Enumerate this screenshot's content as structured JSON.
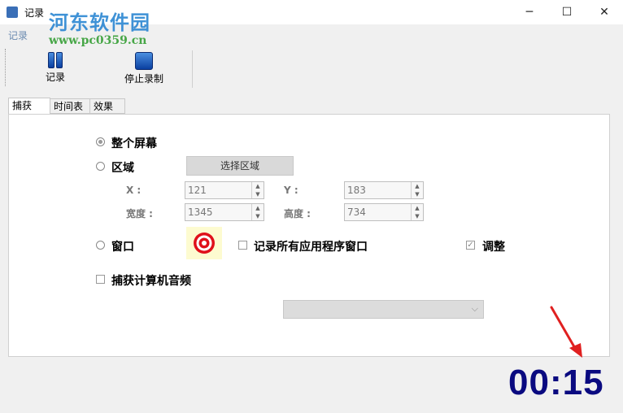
{
  "window": {
    "title": "记录",
    "minimize_glyph": "─",
    "maximize_glyph": "☐",
    "close_glyph": "✕"
  },
  "watermark": {
    "site_name": "河东软件园",
    "url": "www.pc0359.cn"
  },
  "menu": {
    "label": "记录"
  },
  "toolbar": {
    "record_label": "记录",
    "stop_label": "停止录制"
  },
  "tabs": [
    {
      "label": "捕获",
      "active": true
    },
    {
      "label": "时间表",
      "active": false
    },
    {
      "label": "效果",
      "active": false
    }
  ],
  "capture": {
    "fullscreen_label": "整个屏幕",
    "fullscreen_checked": true,
    "region_label": "区域",
    "region_checked": false,
    "select_region_button": "选择区域",
    "x_label": "X :",
    "x_value": "121",
    "y_label": "Y :",
    "y_value": "183",
    "width_label": "宽度 :",
    "width_value": "1345",
    "height_label": "高度 :",
    "height_value": "734",
    "window_label": "窗口",
    "window_checked": false,
    "record_all_windows_label": "记录所有应用程序窗口",
    "record_all_windows_checked": false,
    "adjust_label": "调整",
    "adjust_checked": true,
    "capture_audio_label": "捕获计算机音频",
    "capture_audio_checked": false,
    "audio_device_value": ""
  },
  "timer": {
    "value": "00:15"
  },
  "colors": {
    "timer": "#0a0a80",
    "target_red": "#e0101a",
    "arrow_red": "#e02020",
    "watermark_blue": "#1e7fd0",
    "watermark_green": "#2a9a2a"
  },
  "icons": {
    "app": "app-icon",
    "record": "pause-bars-icon",
    "stop": "stop-square-icon",
    "window_picker": "target-icon",
    "annotation": "red-arrow-icon"
  }
}
